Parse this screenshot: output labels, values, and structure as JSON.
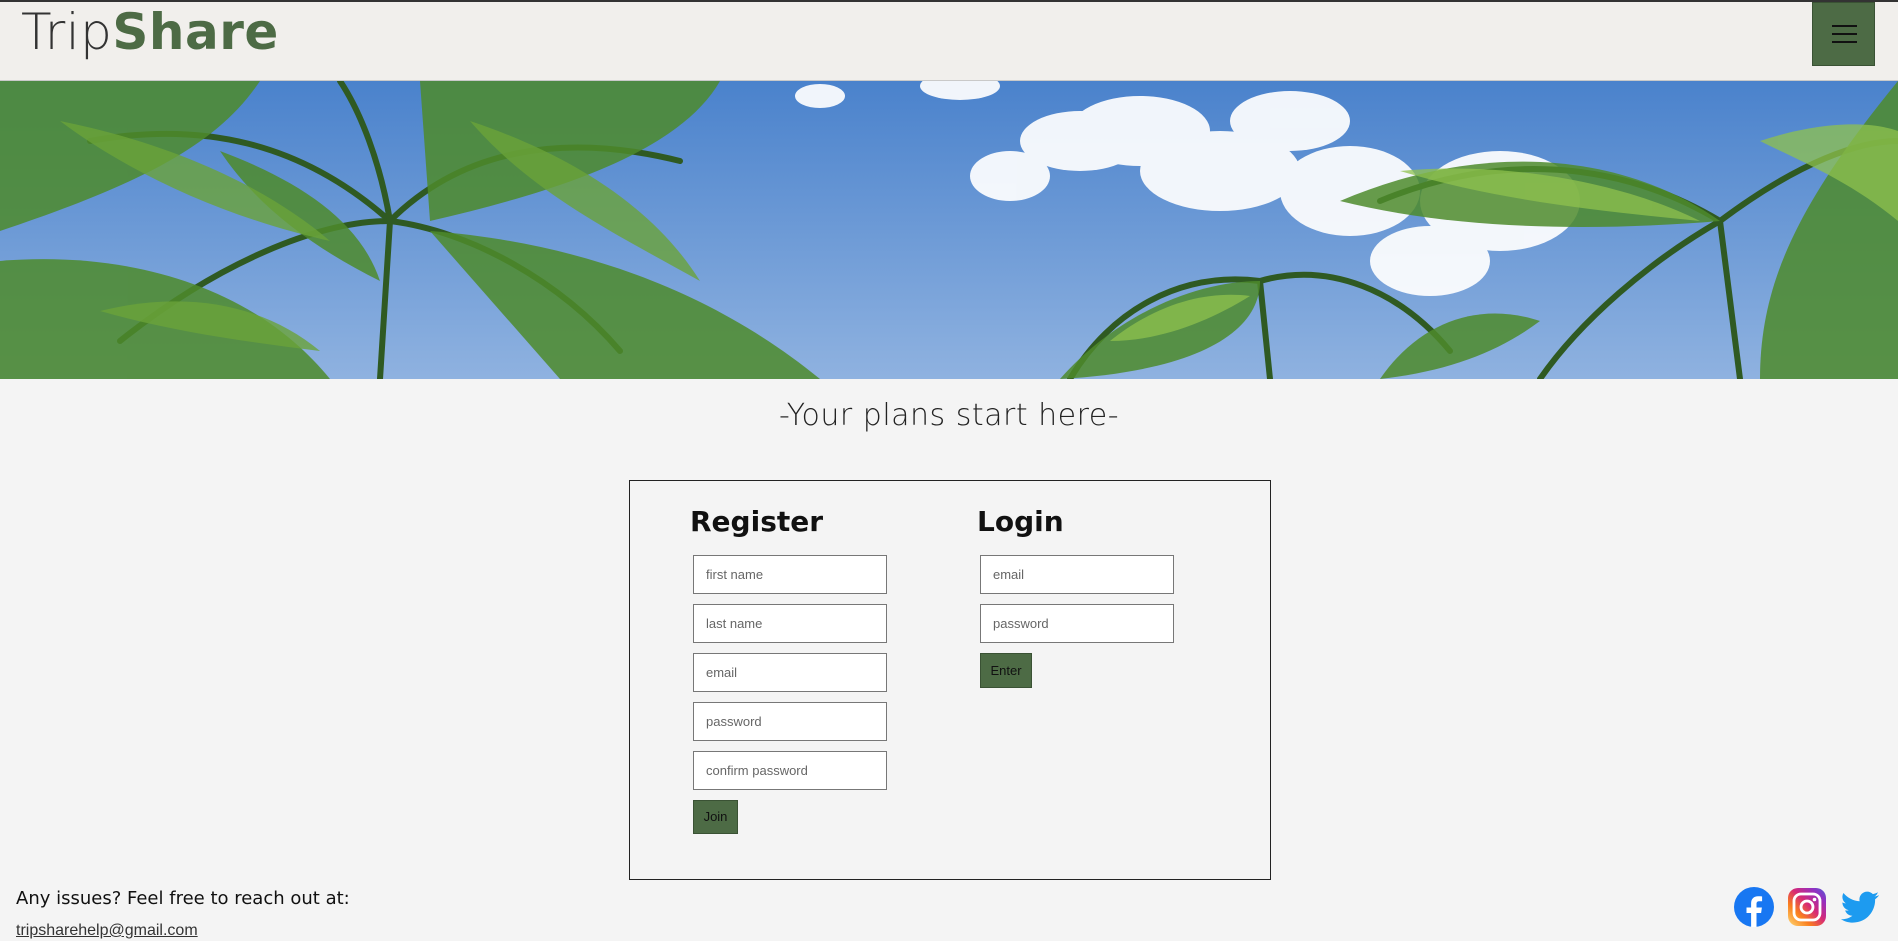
{
  "header": {
    "logo_light": "Trip",
    "logo_bold": "Share"
  },
  "tagline": "-Your plans start here-",
  "register": {
    "title": "Register",
    "first_name_placeholder": "first name",
    "last_name_placeholder": "last name",
    "email_placeholder": "email",
    "password_placeholder": "password",
    "confirm_password_placeholder": "confirm password",
    "join_label": "Join"
  },
  "login": {
    "title": "Login",
    "email_placeholder": "email",
    "password_placeholder": "password",
    "enter_label": "Enter"
  },
  "footer": {
    "issues_text": "Any issues? Feel free to reach out at:",
    "email": "tripsharehelp@gmail.com"
  },
  "social_icons": [
    "facebook-icon",
    "instagram-icon",
    "twitter-icon"
  ],
  "colors": {
    "brand_green": "#4d6b45",
    "header_bg": "#f1efec",
    "page_bg": "#f4f4f4"
  }
}
